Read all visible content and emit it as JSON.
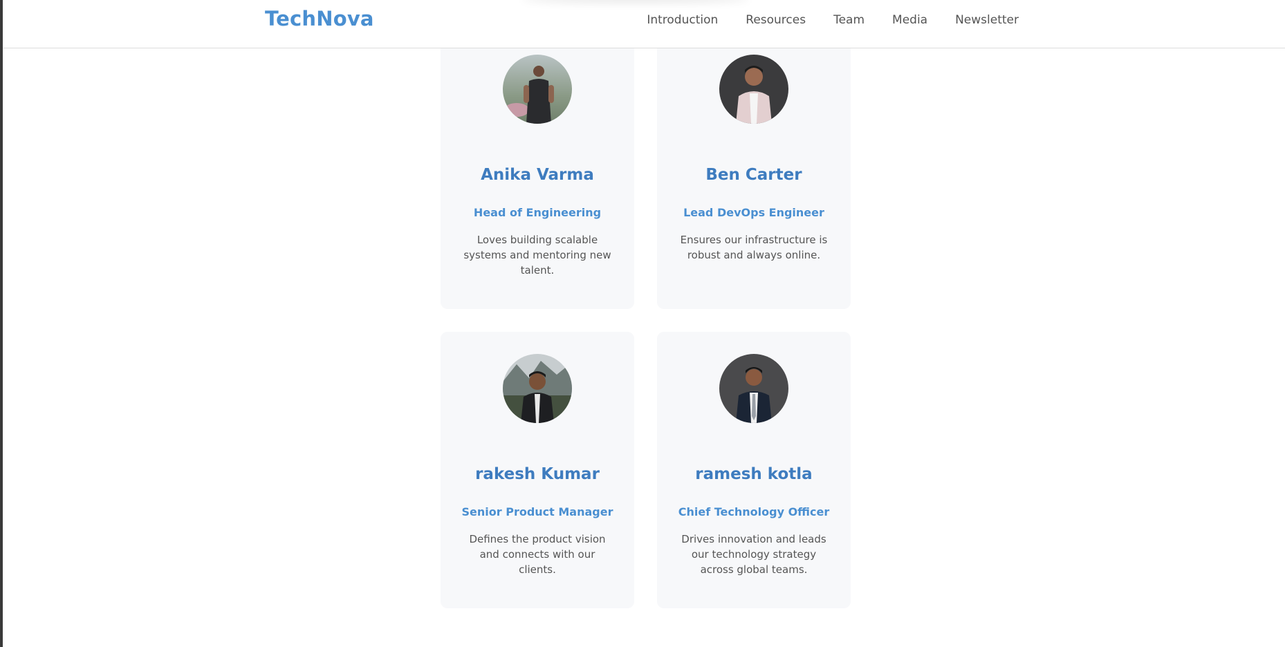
{
  "nav": {
    "logo": "TechNova",
    "links": [
      "Introduction",
      "Resources",
      "Team",
      "Media",
      "Newsletter"
    ]
  },
  "team": [
    {
      "name": "Anika Varma",
      "role": "Head of Engineering",
      "bio": "Loves building scalable systems and mentoring new talent."
    },
    {
      "name": "Ben Carter",
      "role": "Lead DevOps Engineer",
      "bio": "Ensures our infrastructure is robust and always online."
    },
    {
      "name": "rakesh Kumar",
      "role": "Senior Product Manager",
      "bio": "Defines the product vision and connects with our clients."
    },
    {
      "name": "ramesh kotla",
      "role": "Chief Technology Officer",
      "bio": "Drives innovation and leads our technology strategy across global teams."
    }
  ],
  "colors": {
    "accent": "#4a8fd1",
    "name": "#3e7cbf",
    "card_bg": "#f7f8fa"
  }
}
